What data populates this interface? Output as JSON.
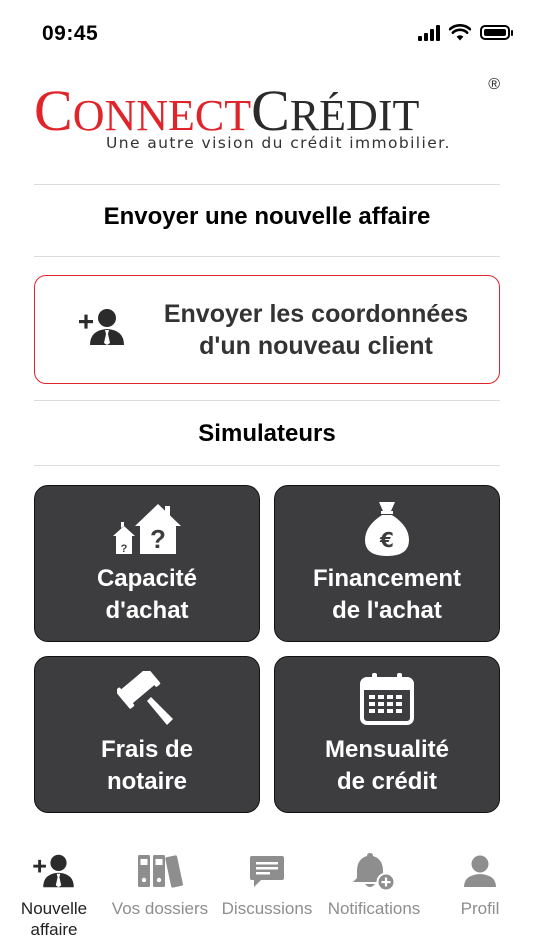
{
  "status_bar": {
    "time": "09:45"
  },
  "logo": {
    "connect_c": "C",
    "connect_rest": "ONNECT",
    "credit_c": "C",
    "credit_rest": "RÉDIT",
    "registered": "®",
    "tagline": "Une autre vision du crédit immobilier."
  },
  "new_business": {
    "title": "Envoyer une nouvelle affaire",
    "send_client_line1": "Envoyer les coordonnées",
    "send_client_line2": "d'un nouveau client"
  },
  "simulators": {
    "title": "Simulateurs",
    "tiles": [
      {
        "line1": "Capacité",
        "line2": "d'achat",
        "icon": "houses-question-icon"
      },
      {
        "line1": "Financement",
        "line2": "de l'achat",
        "icon": "euro-money-bag-icon"
      },
      {
        "line1": "Frais de",
        "line2": "notaire",
        "icon": "gavel-icon"
      },
      {
        "line1": "Mensualité",
        "line2": "de crédit",
        "icon": "calendar-icon"
      }
    ]
  },
  "tabbar": {
    "tabs": [
      {
        "label_line1": "Nouvelle",
        "label_line2": "affaire",
        "icon": "add-user-icon",
        "active": true
      },
      {
        "label_line1": "Vos dossiers",
        "label_line2": "",
        "icon": "binders-icon",
        "active": false
      },
      {
        "label_line1": "Discussions",
        "label_line2": "",
        "icon": "chat-bubble-icon",
        "active": false
      },
      {
        "label_line1": "Notifications",
        "label_line2": "",
        "icon": "bell-plus-icon",
        "active": false
      },
      {
        "label_line1": "Profil",
        "label_line2": "",
        "icon": "user-icon",
        "active": false
      }
    ]
  },
  "colors": {
    "brand_red": "#e0242a",
    "tile_bg": "#3d3c3e",
    "inactive_tab": "#8e8e8e"
  }
}
